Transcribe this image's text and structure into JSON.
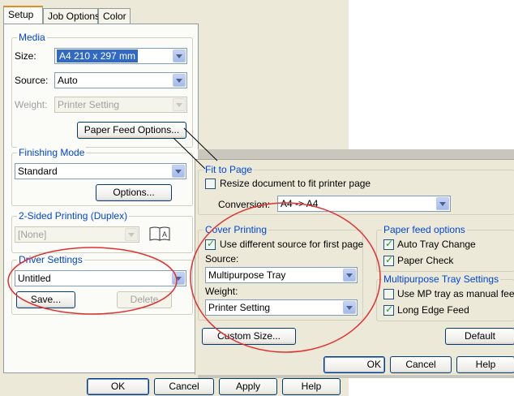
{
  "main_dialog": {
    "tabs": [
      {
        "label": "Setup"
      },
      {
        "label": "Job Options"
      },
      {
        "label": "Color"
      }
    ],
    "media": {
      "title": "Media",
      "size_label": "Size:",
      "size_value": "A4 210 x 297 mm",
      "source_label": "Source:",
      "source_value": "Auto",
      "weight_label": "Weight:",
      "weight_value": "Printer Setting",
      "paper_feed_options_button": "Paper Feed Options..."
    },
    "finishing": {
      "title": "Finishing Mode",
      "value": "Standard",
      "options_button": "Options..."
    },
    "duplex": {
      "title": "2-Sided Printing (Duplex)",
      "value": "[None]"
    },
    "driver_settings": {
      "title": "Driver Settings",
      "value": "Untitled",
      "save_button": "Save...",
      "delete_button": "Delete"
    },
    "footer": {
      "ok": "OK",
      "cancel": "Cancel",
      "apply": "Apply",
      "help": "Help"
    }
  },
  "paper_feed_dialog": {
    "fit_to_page": {
      "title": "Fit to Page",
      "resize_label": "Resize document to fit printer page",
      "resize_checked": false,
      "conversion_label": "Conversion:",
      "conversion_value": "A4 -> A4"
    },
    "cover_printing": {
      "title": "Cover Printing",
      "different_source_label": "Use different source for first page",
      "different_source_checked": true,
      "source_label": "Source:",
      "source_value": "Multipurpose Tray",
      "weight_label": "Weight:",
      "weight_value": "Printer Setting"
    },
    "paper_feed_options": {
      "title": "Paper feed options",
      "auto_tray_change": "Auto Tray Change",
      "auto_tray_change_checked": true,
      "paper_check": "Paper Check",
      "paper_check_checked": true
    },
    "mp_tray": {
      "title": "Multipurpose Tray Settings",
      "manual_feed": "Use MP tray as manual feed",
      "manual_feed_checked": false,
      "long_edge_feed": "Long Edge Feed",
      "long_edge_feed_checked": true
    },
    "custom_size_button": "Custom Size...",
    "default_button": "Default",
    "footer": {
      "ok": "OK",
      "cancel": "Cancel",
      "help": "Help"
    }
  },
  "colors": {
    "dialog_bg": "#ece9d8",
    "panel_bg": "#fbfbf8",
    "group_title": "#0046d5",
    "selection": "#316ac5",
    "annotation_red": "#e03030"
  }
}
